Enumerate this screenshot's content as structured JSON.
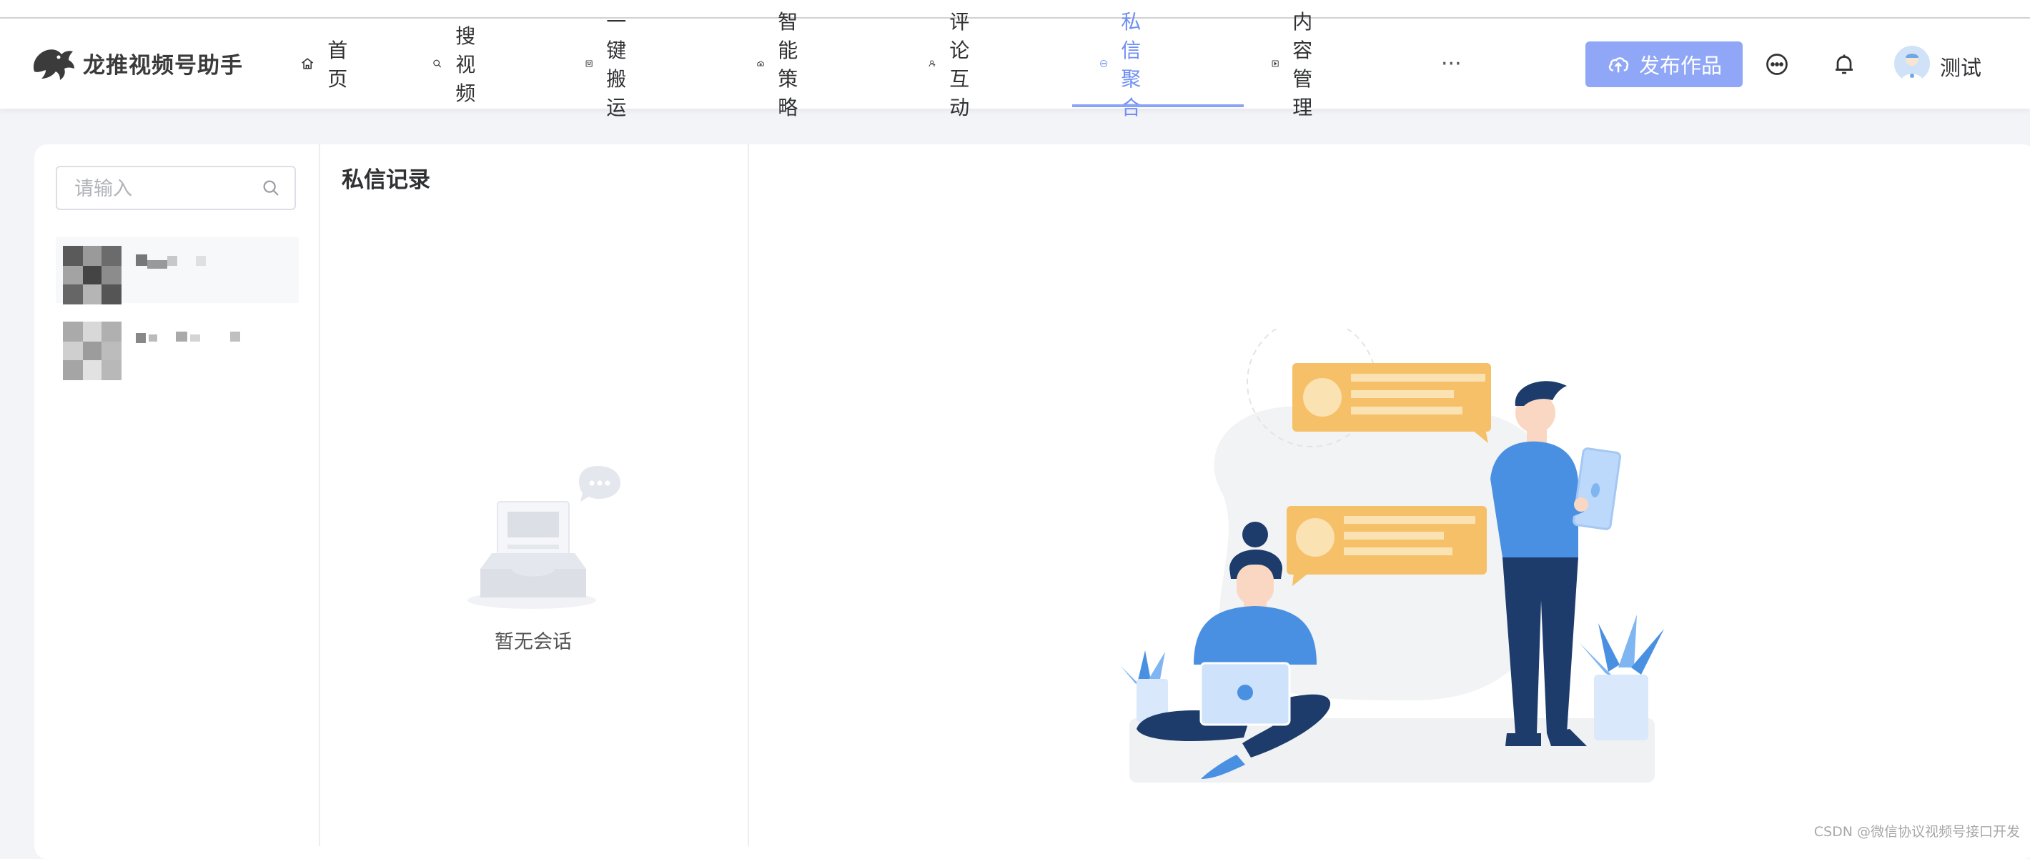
{
  "app": {
    "title": "龙推视频号助手"
  },
  "nav": {
    "items": [
      {
        "label": "首页",
        "icon": "home-icon"
      },
      {
        "label": "搜视频",
        "icon": "search-icon"
      },
      {
        "label": "一键搬运",
        "icon": "robot-icon"
      },
      {
        "label": "智能策略",
        "icon": "cloud-eye-icon"
      },
      {
        "label": "评论互动",
        "icon": "user-icon"
      },
      {
        "label": "私信聚合",
        "icon": "message-icon",
        "active": true
      },
      {
        "label": "内容管理",
        "icon": "play-square-icon"
      }
    ],
    "more_label": "···"
  },
  "header": {
    "publish_label": "发布作品",
    "user_name": "测试"
  },
  "contacts": {
    "search_placeholder": "请输入",
    "items": [
      {
        "name": ""
      },
      {
        "name": ""
      }
    ]
  },
  "messages": {
    "title": "私信记录",
    "empty_text": "暂无会话"
  },
  "colors": {
    "accent": "#6f8ff4",
    "publish_bg": "#8fa7f6",
    "bubble": "#f6c068",
    "figure_blue": "#4a90e2",
    "figure_navy": "#1d3c6b"
  },
  "footer": {
    "watermark": "CSDN @微信协议视频号接口开发"
  }
}
